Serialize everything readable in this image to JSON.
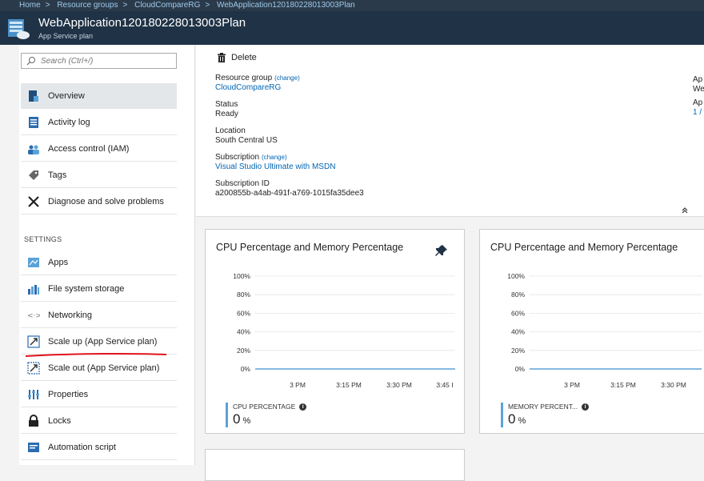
{
  "breadcrumb": [
    "Home",
    "Resource groups",
    "CloudCompareRG",
    "WebApplication120180228013003Plan"
  ],
  "header": {
    "title": "WebApplication120180228013003Plan",
    "subtitle": "App Service plan"
  },
  "search": {
    "placeholder": "Search (Ctrl+/)"
  },
  "sidebar": {
    "items": [
      {
        "label": "Overview",
        "icon": "overview-icon"
      },
      {
        "label": "Activity log",
        "icon": "activity-log-icon"
      },
      {
        "label": "Access control (IAM)",
        "icon": "people-icon"
      },
      {
        "label": "Tags",
        "icon": "tag-icon"
      },
      {
        "label": "Diagnose and solve problems",
        "icon": "wrench-icon"
      }
    ],
    "section": "SETTINGS",
    "settings": [
      {
        "label": "Apps",
        "icon": "apps-icon"
      },
      {
        "label": "File system storage",
        "icon": "storage-icon"
      },
      {
        "label": "Networking",
        "icon": "networking-icon"
      },
      {
        "label": "Scale up (App Service plan)",
        "icon": "scale-up-icon"
      },
      {
        "label": "Scale out (App Service plan)",
        "icon": "scale-out-icon"
      },
      {
        "label": "Properties",
        "icon": "properties-icon"
      },
      {
        "label": "Locks",
        "icon": "lock-icon"
      },
      {
        "label": "Automation script",
        "icon": "automation-icon"
      }
    ]
  },
  "toolbar": {
    "delete_label": "Delete"
  },
  "essentials": {
    "resource_group_label": "Resource group",
    "change": "(change)",
    "resource_group_value": "CloudCompareRG",
    "status_label": "Status",
    "status_value": "Ready",
    "location_label": "Location",
    "location_value": "South Central US",
    "subscription_label": "Subscription",
    "subscription_value": "Visual Studio Ultimate with MSDN",
    "subscription_id_label": "Subscription ID",
    "subscription_id_value": "a200855b-a4ab-491f-a769-1015fa35dee3",
    "right_col": [
      "Ap",
      "We",
      "Ap",
      "1 /"
    ]
  },
  "tiles": [
    {
      "title": "CPU Percentage and Memory Percentage",
      "metric_label": "CPU PERCENTAGE",
      "metric_value": "0",
      "metric_unit": "%",
      "x_ticks": [
        "3 PM",
        "3:15 PM",
        "3:30 PM",
        "3:45 I"
      ]
    },
    {
      "title": "CPU Percentage and Memory Percentage",
      "metric_label": "MEMORY PERCENT...",
      "metric_value": "0",
      "metric_unit": "%",
      "x_ticks": [
        "3 PM",
        "3:15 PM",
        "3:30 PM"
      ]
    }
  ],
  "chart_data": [
    {
      "type": "line",
      "title": "CPU Percentage and Memory Percentage",
      "y_ticks": [
        "100%",
        "80%",
        "60%",
        "40%",
        "20%",
        "0%"
      ],
      "ylim": [
        0,
        100
      ],
      "x": [
        "3 PM",
        "3:15 PM",
        "3:30 PM",
        "3:45 I"
      ],
      "series": [
        {
          "name": "CPU PERCENTAGE",
          "values": [
            0,
            0,
            0,
            0
          ]
        }
      ]
    },
    {
      "type": "line",
      "title": "CPU Percentage and Memory Percentage",
      "y_ticks": [
        "100%",
        "80%",
        "60%",
        "40%",
        "20%",
        "0%"
      ],
      "ylim": [
        0,
        100
      ],
      "x": [
        "3 PM",
        "3:15 PM",
        "3:30 PM"
      ],
      "series": [
        {
          "name": "MEMORY PERCENT...",
          "values": [
            0,
            0,
            0
          ]
        }
      ]
    }
  ],
  "colors": {
    "header_bg": "#1f3246",
    "breadcrumb_bg": "#2b3a4a",
    "link": "#0065b3",
    "chart_line": "#5aa3d8",
    "annotation_red": "#e0141e"
  }
}
